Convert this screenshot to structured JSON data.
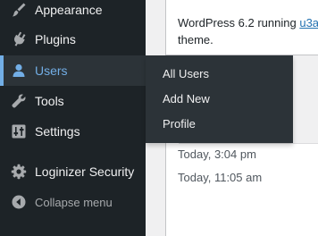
{
  "sidebar": {
    "items": [
      {
        "label": "Appearance",
        "icon": "paintbrush-icon"
      },
      {
        "label": "Plugins",
        "icon": "plugin-icon"
      },
      {
        "label": "Users",
        "icon": "user-icon",
        "current": true
      },
      {
        "label": "Tools",
        "icon": "wrench-icon"
      },
      {
        "label": "Settings",
        "icon": "settings-sliders-icon"
      },
      {
        "label": "Loginizer Security",
        "icon": "gear-icon"
      }
    ],
    "collapse_label": "Collapse menu"
  },
  "users_submenu": {
    "items": [
      "All Users",
      "Add New",
      "Profile"
    ]
  },
  "at_a_glance": {
    "text_before": "WordPress 6.2 running ",
    "theme_link": "u3a",
    "text_after": "theme."
  },
  "activity": {
    "times": [
      "Today, 3:04 pm",
      "Today, 11:05 am"
    ]
  },
  "colors": {
    "sidebar_bg": "#1d2327",
    "submenu_bg": "#2c3338",
    "accent": "#72aee6",
    "link": "#2271b1"
  }
}
